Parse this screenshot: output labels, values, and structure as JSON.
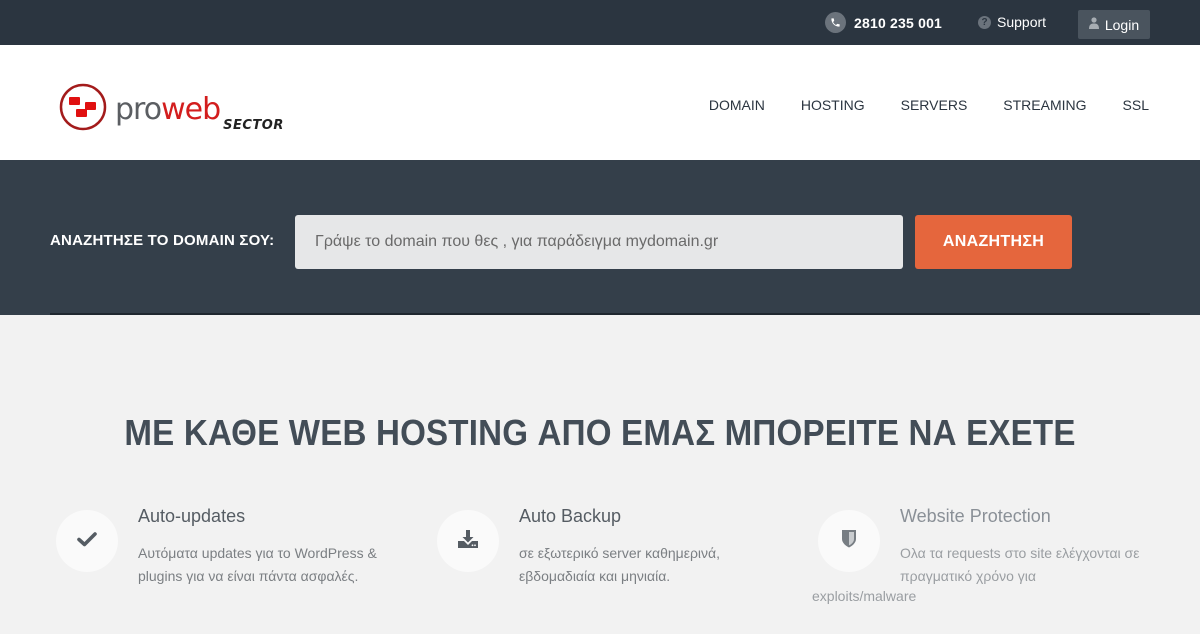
{
  "topbar": {
    "phone": "2810 235 001",
    "support_label": "Support",
    "login_label": "Login",
    "icons": {
      "phone": "phone-icon",
      "support": "question-icon",
      "login": "user-icon"
    }
  },
  "brand": {
    "logo_pro": "pro",
    "logo_web": "web",
    "logo_sector": "SECTOR",
    "colors": {
      "red": "#d31d1d",
      "gray": "#5b5e62"
    }
  },
  "nav": {
    "items": [
      {
        "label": "DOMAIN"
      },
      {
        "label": "HOSTING"
      },
      {
        "label": "SERVERS"
      },
      {
        "label": "STREAMING"
      },
      {
        "label": "SSL"
      }
    ]
  },
  "search": {
    "label": "ΑΝΑΖΗΤΗΣΕ ΤΟ DOMAIN ΣΟΥ:",
    "placeholder": "Γράψε το domain που θες , για παράδειγμα mydomain.gr",
    "value": "",
    "button_label": "ΑΝΑΖΗΤΗΣΗ",
    "button_color": "#e5663d"
  },
  "features": {
    "title": "ΜΕ ΚΑΘΕ WEB HOSTING ΑΠΟ ΕΜΑΣ ΜΠΟΡΕΙΤΕ ΝΑ ΕΧΕΤΕ",
    "items": [
      {
        "icon": "check-icon",
        "title": "Auto-updates",
        "description": "Αυτόματα updates για το WordPress & plugins για να είναι πάντα ασφαλές."
      },
      {
        "icon": "download-icon",
        "title": "Auto Backup",
        "description": "σε εξωτερικό server καθημερινά, εβδομαδιαία και μηνιαία."
      },
      {
        "icon": "shield-icon",
        "title": "Website Protection",
        "description": "Ολα τα requests στο site ελέγχονται σε πραγματικό χρόνο για",
        "description_tail": "exploits/malware"
      }
    ]
  }
}
